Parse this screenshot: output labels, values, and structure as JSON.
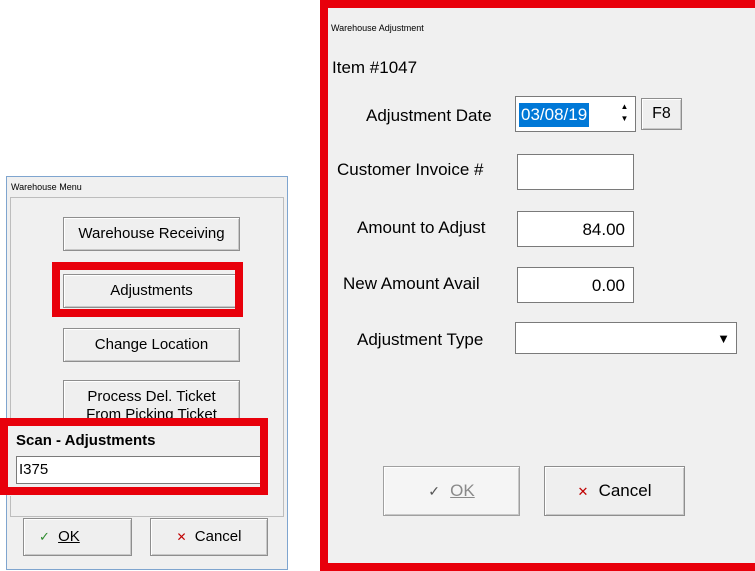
{
  "menu": {
    "title": "Warehouse Menu",
    "receiving_label": "Warehouse Receiving",
    "adjustments_label": "Adjustments",
    "change_location_label": "Change Location",
    "process_line1": "Process Del. Ticket",
    "process_line2": "From Picking Ticket",
    "scan_title": "Scan - Adjustments",
    "scan_value": "I375",
    "ok_label": "OK",
    "cancel_label": "Cancel"
  },
  "adjust": {
    "title": "Warehouse Adjustment",
    "item": "Item #1047",
    "date_label": "Adjustment Date",
    "date_value": "03/08/19",
    "f8_label": "F8",
    "invoice_label": "Customer Invoice #",
    "invoice_value": "",
    "amount_label": "Amount to Adjust",
    "amount_value": "84.00",
    "new_amount_label": "New Amount Avail",
    "new_amount_value": "0.00",
    "type_label": "Adjustment Type",
    "type_value": "",
    "ok_label": "OK",
    "cancel_label": "Cancel"
  },
  "icons": {
    "check": "check-icon",
    "cross": "cross-icon",
    "spin": "spin-arrows-icon",
    "dropdown": "dropdown-arrow-icon"
  },
  "colors": {
    "highlight": "#e8000b",
    "selection": "#0078d7"
  }
}
